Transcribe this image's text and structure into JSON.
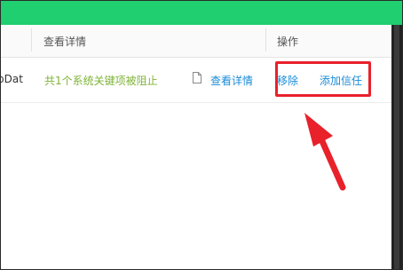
{
  "table": {
    "columns": [
      "查看详情",
      "操作"
    ],
    "rows": [
      {
        "path_fragment": "pDat",
        "status": "共1个系统关键项被阻止",
        "details": "查看详情",
        "remove": "移除",
        "add_trust": "添加信任"
      }
    ]
  },
  "colors": {
    "title_bar": "#1fcf70",
    "status_text": "#7fb337",
    "link": "#1a8cd8",
    "highlight": "#e8212b"
  },
  "icons": {
    "details": "document-icon",
    "annotation": "arrow-icon"
  }
}
